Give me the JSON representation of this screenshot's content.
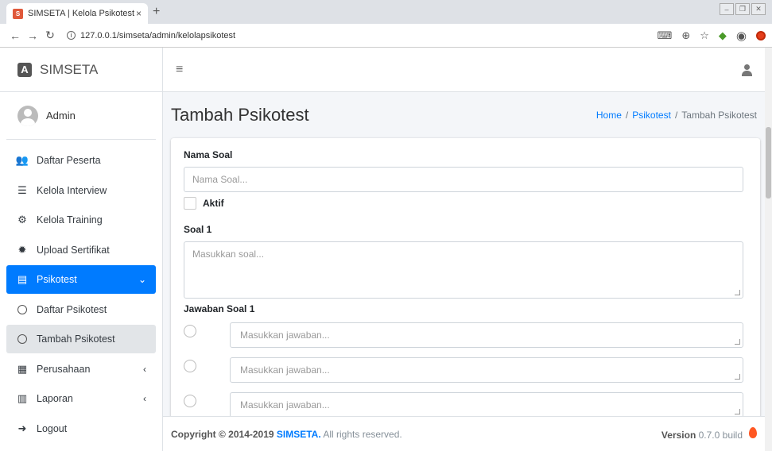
{
  "browser": {
    "tab_title": "SIMSETA | Kelola Psikotest",
    "tab_close": "×",
    "new_tab": "+",
    "url": "127.0.0.1/simseta/admin/kelolapsikotest"
  },
  "sidebar": {
    "brand": "SIMSETA",
    "user": "Admin",
    "items": [
      {
        "label": "Daftar Peserta",
        "icon": "users-icon"
      },
      {
        "label": "Kelola Interview",
        "icon": "list-icon"
      },
      {
        "label": "Kelola Training",
        "icon": "cogs-icon"
      },
      {
        "label": "Upload Sertifikat",
        "icon": "certificate-icon"
      },
      {
        "label": "Psikotest",
        "icon": "file-icon"
      },
      {
        "label": "Daftar Psikotest",
        "icon": "circle-icon"
      },
      {
        "label": "Tambah Psikotest",
        "icon": "circle-icon"
      },
      {
        "label": "Perusahaan",
        "icon": "building-icon"
      },
      {
        "label": "Laporan",
        "icon": "file-alt-icon"
      },
      {
        "label": "Logout",
        "icon": "sign-out-icon"
      }
    ],
    "accent_color": "#007bff"
  },
  "header": {
    "title": "Tambah Psikotest",
    "breadcrumb": [
      "Home",
      "Psikotest",
      "Tambah Psikotest"
    ]
  },
  "form": {
    "nama_soal_label": "Nama Soal",
    "nama_soal_placeholder": "Nama Soal...",
    "aktif_label": "Aktif",
    "soal1_label": "Soal 1",
    "soal1_placeholder": "Masukkan soal...",
    "jawaban1_label": "Jawaban Soal 1",
    "answers": [
      "Masukkan jawaban...",
      "Masukkan jawaban...",
      "Masukkan jawaban..."
    ]
  },
  "footer": {
    "copyright_prefix": "Copyright © 2014-2019 ",
    "brand": "SIMSETA.",
    "suffix": " All rights reserved.",
    "version_label": "Version",
    "version_value": " 0.7.0 build"
  }
}
